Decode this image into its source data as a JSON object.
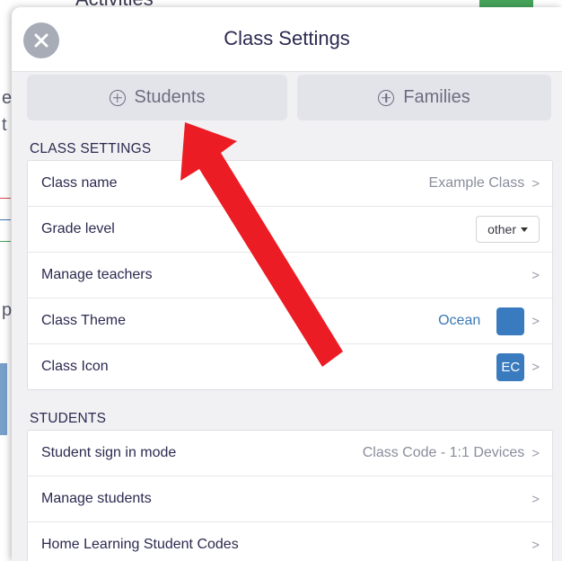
{
  "background": {
    "title_fragment": "Activities",
    "letters": [
      "e",
      "t",
      "p"
    ]
  },
  "modal": {
    "title": "Class Settings",
    "close_icon": "close-icon"
  },
  "add_buttons": {
    "students_label": "Students",
    "families_label": "Families"
  },
  "class_settings": {
    "section_label": "CLASS SETTINGS",
    "rows": [
      {
        "label": "Class name",
        "value": "Example Class",
        "chevron": ">"
      },
      {
        "label": "Grade level",
        "select_value": "other"
      },
      {
        "label": "Manage teachers",
        "chevron": ">"
      },
      {
        "label": "Class Theme",
        "value": "Ocean",
        "swatch_color": "#3a7bbf",
        "chevron": ">"
      },
      {
        "label": "Class Icon",
        "icon_text": "EC",
        "chevron": ">"
      }
    ]
  },
  "students": {
    "section_label": "STUDENTS",
    "rows": [
      {
        "label": "Student sign in mode",
        "value": "Class Code - 1:1 Devices",
        "chevron": ">"
      },
      {
        "label": "Manage students",
        "chevron": ">"
      },
      {
        "label": "Home Learning Student Codes",
        "chevron": ">"
      }
    ]
  },
  "colors": {
    "accent_blue": "#3a78b5",
    "annotation_arrow": "#ec1c24"
  }
}
